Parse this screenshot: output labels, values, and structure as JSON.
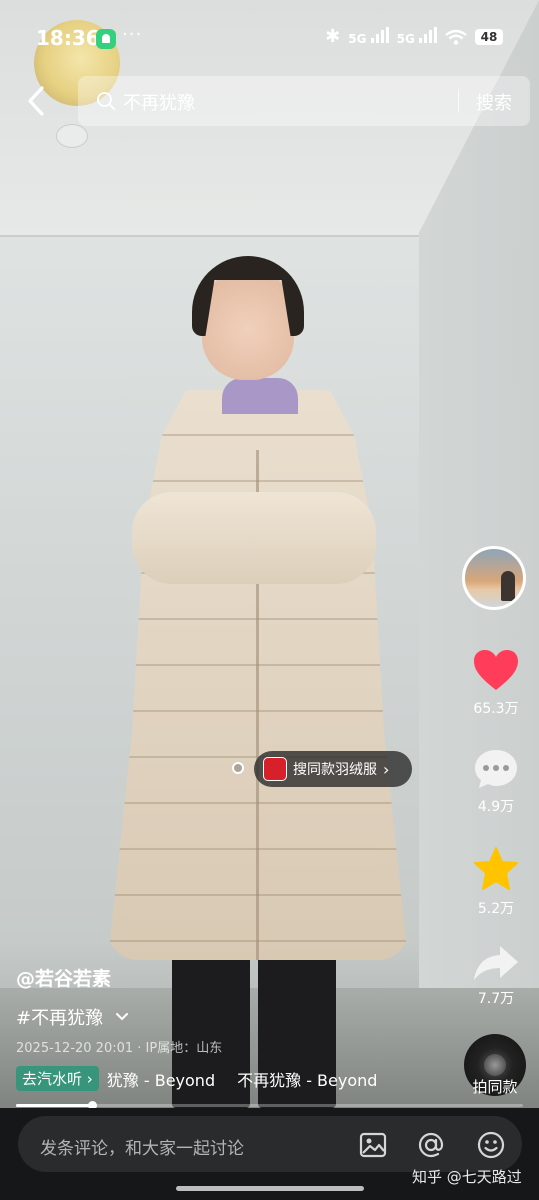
{
  "status_bar": {
    "time": "18:36",
    "more": "···",
    "bluetooth_icon": "bluetooth-icon",
    "signal_1_label": "5G",
    "signal_2_label": "5G",
    "wifi_icon": "wifi-icon",
    "battery_level": "48"
  },
  "search": {
    "back_icon": "chevron-left-icon",
    "query": "不再犹豫",
    "button_label": "搜索"
  },
  "actions": {
    "likes": "65.3万",
    "comments": "4.9万",
    "favorites": "5.2万",
    "shares": "7.7万",
    "like_color": "#ff3d5a",
    "favorite_color": "#ffc300"
  },
  "product_tag": {
    "label": "搜同款羽绒服",
    "chevron": "›"
  },
  "video_info": {
    "author": "@若谷若素",
    "hashtag": "#不再犹豫",
    "expand_icon": "chevron-down-icon",
    "meta": "2025-12-20 20:01 · IP属地：山东",
    "music_pill": "去汽水听 ›",
    "music_titles": [
      "犹豫 - Beyond",
      "不再犹豫 - Beyond"
    ],
    "shoot_same_label": "拍同款"
  },
  "progress": {
    "played_fraction": 0.15
  },
  "comment_bar": {
    "placeholder": "发条评论，和大家一起讨论",
    "image_icon": "image-icon",
    "mention_icon": "at-icon",
    "emoji_icon": "emoji-icon"
  },
  "watermark": "知乎 @七天路过"
}
